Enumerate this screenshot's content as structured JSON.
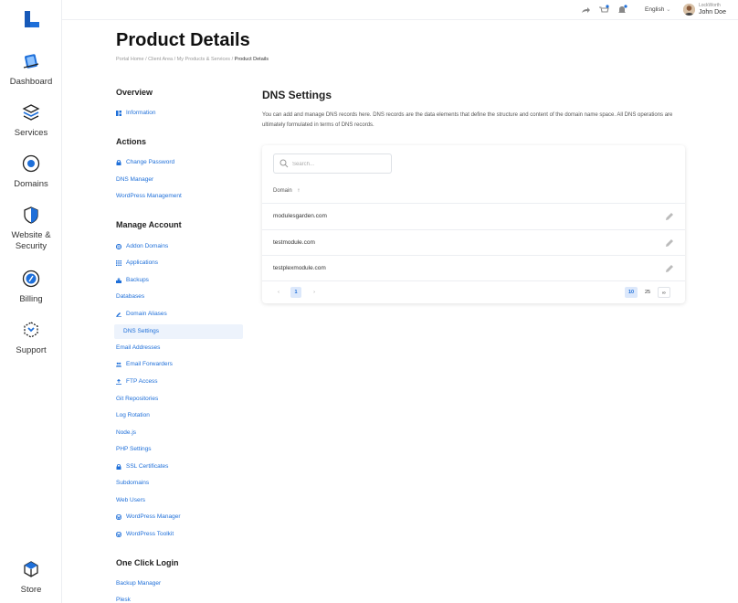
{
  "nav": {
    "items": [
      {
        "label": "Dashboard"
      },
      {
        "label": "Services"
      },
      {
        "label": "Domains"
      },
      {
        "label": "Website & Security"
      },
      {
        "label": "Billing"
      },
      {
        "label": "Support"
      },
      {
        "label": "Store"
      }
    ]
  },
  "topbar": {
    "language": "English",
    "company": "LockWorth",
    "user_name": "John Doe"
  },
  "header": {
    "title": "Product Details",
    "breadcrumb": [
      "Portal Home",
      "Client Area",
      "My Products & Services",
      "Product Details"
    ]
  },
  "sidemenu": {
    "overview_heading": "Overview",
    "information": "Information",
    "actions_heading": "Actions",
    "actions": [
      "Change Password",
      "DNS Manager",
      "WordPress Management"
    ],
    "manage_heading": "Manage Account",
    "manage": [
      "Addon Domains",
      "Applications",
      "Backups",
      "Databases",
      "Domain Aliases",
      "DNS Settings",
      "Email Addresses",
      "Email Forwarders",
      "FTP Access",
      "Git Repositories",
      "Log Rotation",
      "Node.js",
      "PHP Settings",
      "SSL Certificates",
      "Subdomains",
      "Web Users",
      "WordPress Manager",
      "WordPress Toolkit"
    ],
    "oneclick_heading": "One Click Login",
    "oneclick": [
      "Backup Manager",
      "Plesk"
    ]
  },
  "main": {
    "title": "DNS Settings",
    "description": "You can add and manage DNS records here. DNS records are the data elements that define the structure and content of the domain name space. All DNS operations are ultimately formulated in terms of DNS records.",
    "search_placeholder": "Search...",
    "column_header": "Domain",
    "sort_indicator": "↑",
    "rows": [
      "modulesgarden.com",
      "testmodule.com",
      "testplexmodule.com"
    ],
    "pagination": {
      "prev": "‹",
      "current_page": "1",
      "next": "›",
      "page_sizes": [
        "10",
        "25",
        "∞"
      ],
      "active_size": "10"
    }
  },
  "colors": {
    "accent": "#1e6fd9",
    "active_bg": "#edf3fc"
  }
}
